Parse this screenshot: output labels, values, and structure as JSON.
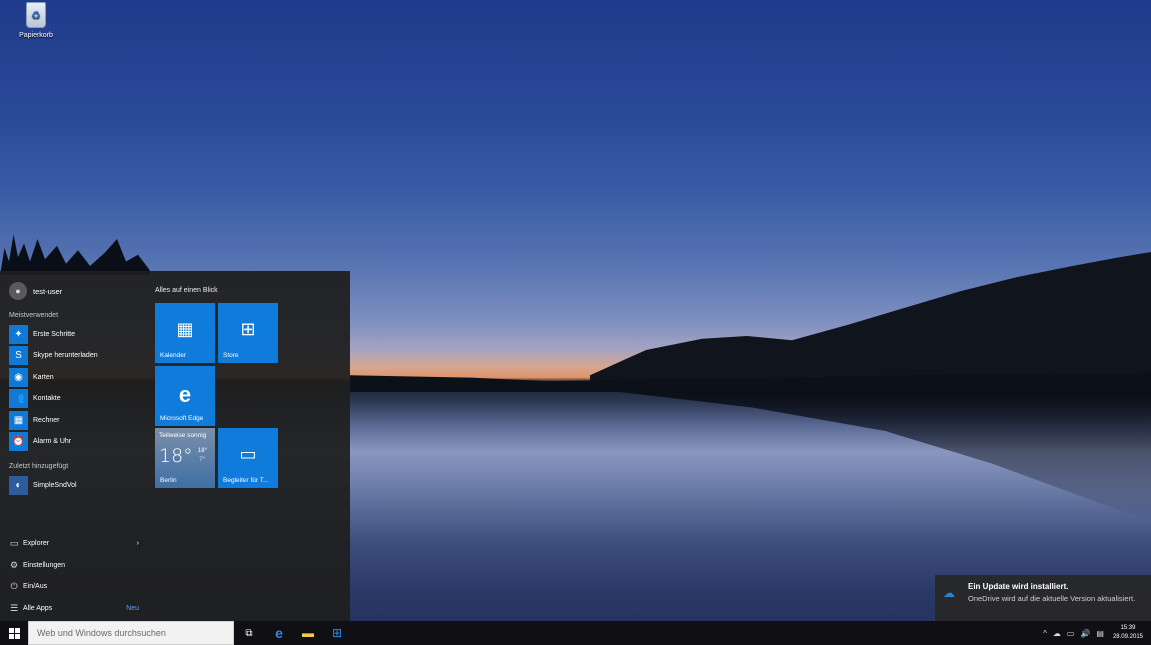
{
  "desktop": {
    "icons": [
      {
        "label": "Papierkorb",
        "icon": "recycle-bin-icon"
      }
    ]
  },
  "start_menu": {
    "user": {
      "name": "test-user",
      "icon": "user-icon"
    },
    "most_used_label": "Meistverwendet",
    "most_used": [
      {
        "label": "Erste Schritte",
        "icon": "lightbulb-icon"
      },
      {
        "label": "Skype herunterladen",
        "icon": "skype-icon"
      },
      {
        "label": "Karten",
        "icon": "maps-icon"
      },
      {
        "label": "Kontakte",
        "icon": "people-icon"
      },
      {
        "label": "Rechner",
        "icon": "calculator-icon"
      },
      {
        "label": "Alarm & Uhr",
        "icon": "alarm-icon"
      }
    ],
    "recently_added_label": "Zuletzt hinzugefügt",
    "recently_added": [
      {
        "label": "SimpleSndVol",
        "icon": "volume-app-icon"
      }
    ],
    "bottom": {
      "explorer": "Explorer",
      "settings": "Einstellungen",
      "power": "Ein/Aus",
      "all_apps": "Alle Apps",
      "all_apps_badge": "Neu"
    },
    "tiles_label": "Alles auf einen Blick",
    "tiles": {
      "calendar": "Kalender",
      "store": "Store",
      "edge": "Microsoft Edge",
      "phone": "Begleiter für T..."
    },
    "weather": {
      "condition": "Teilweise sonnig",
      "temp": "18°",
      "high": "18°",
      "low": "7°",
      "city": "Berlin"
    }
  },
  "taskbar": {
    "search_placeholder": "Web und Windows durchsuchen",
    "time": "15:39",
    "date": "28.09.2015"
  },
  "toast": {
    "title": "Ein Update wird installiert.",
    "body": "OneDrive wird auf die aktuelle Version aktualisiert."
  },
  "colors": {
    "accent": "#0f7bdb",
    "start_bg": "#1f1f1f",
    "taskbar_bg": "#101014",
    "badge": "#4da3ff"
  }
}
